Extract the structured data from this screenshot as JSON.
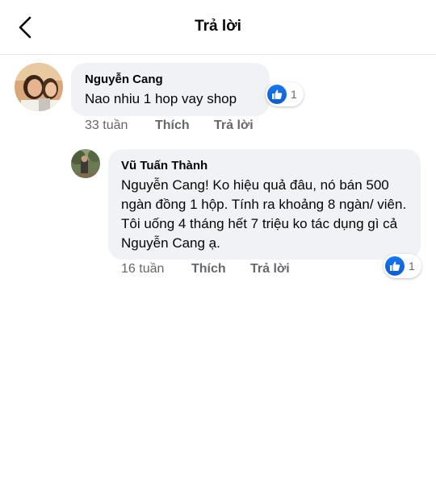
{
  "header": {
    "title": "Trả lời"
  },
  "comments": [
    {
      "author": "Nguyễn Cang",
      "text": "Nao nhiu 1 hop vay shop",
      "time": "33 tuần",
      "like_label": "Thích",
      "reply_label": "Trả lời",
      "reaction_count": "1",
      "reaction_icon": "like-icon"
    },
    {
      "author": "Vũ Tuấn Thành",
      "text": "Nguyễn Cang! Ko hiệu quả đâu, nó bán 500 ngàn đồng 1 hộp. Tính ra khoảng 8 ngàn/ viên. Tôi uống 4 tháng hết 7 triệu ko tác dụng gì cả Nguyễn Cang ạ.",
      "time": "16 tuần",
      "like_label": "Thích",
      "reply_label": "Trả lời",
      "reaction_count": "1",
      "reaction_icon": "like-icon"
    }
  ],
  "colors": {
    "like_blue": "#1877f2",
    "bubble_gray": "#f0f2f5",
    "meta_gray": "#65676b"
  }
}
